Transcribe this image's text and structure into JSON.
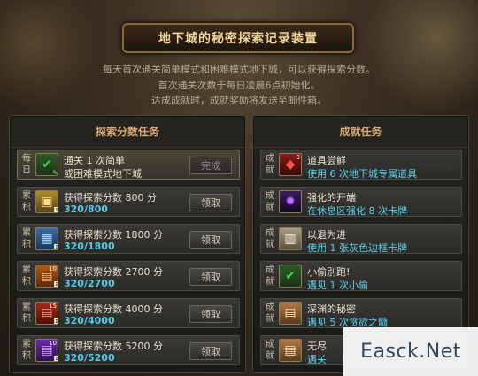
{
  "header": {
    "title": "地下城的秘密探索记录装置",
    "desc": [
      "每天首次通关简单模式和困难模式地下城，可以获得探索分数。",
      "首次通关次数于每日凌晨6点初始化。",
      "达成成就时，成就奖励将发送至邮件箱。"
    ]
  },
  "left_panel": {
    "title": "探索分数任务",
    "rows": [
      {
        "cat": [
          "每",
          "日"
        ],
        "line1": "通关 1 次简单",
        "line2": "或困难模式地下城",
        "button": "完成",
        "icon": "green-check-icon",
        "icon_num": ""
      },
      {
        "cat": [
          "累",
          "积"
        ],
        "line1": "获得探索分数 800 分",
        "line2": "320/800",
        "button": "领取",
        "icon": "gold-chest-icon",
        "icon_num": ""
      },
      {
        "cat": [
          "累",
          "积"
        ],
        "line1": "获得探索分数 1800 分",
        "line2": "320/1800",
        "button": "领取",
        "icon": "blue-gift-icon",
        "icon_num": ""
      },
      {
        "cat": [
          "累",
          "积"
        ],
        "line1": "获得探索分数 2700 分",
        "line2": "320/2700",
        "button": "领取",
        "icon": "orange-box-icon",
        "icon_num": "10"
      },
      {
        "cat": [
          "累",
          "积"
        ],
        "line1": "获得探索分数 4000 分",
        "line2": "320/4000",
        "button": "领取",
        "icon": "red-box-icon",
        "icon_num": "15"
      },
      {
        "cat": [
          "累",
          "积"
        ],
        "line1": "获得探索分数 5200 分",
        "line2": "320/5200",
        "button": "领取",
        "icon": "purple-box-icon",
        "icon_num": "10"
      }
    ]
  },
  "right_panel": {
    "title": "成就任务",
    "rows": [
      {
        "cat": [
          "成",
          "就"
        ],
        "line1": "道具尝鲜",
        "line2": "使用 6 次地下城专属道具",
        "icon": "red-gem-icon",
        "icon_num": "3"
      },
      {
        "cat": [
          "成",
          "就"
        ],
        "line1": "强化的开端",
        "line2": "在休息区强化 8 次卡牌",
        "icon": "purple-gem-icon",
        "icon_num": ""
      },
      {
        "cat": [
          "成",
          "就"
        ],
        "line1": "以退为进",
        "line2": "使用 1 张灰色边框卡牌",
        "icon": "card-icon",
        "icon_num": ""
      },
      {
        "cat": [
          "成",
          "就"
        ],
        "line1": "小偷别跑!",
        "line2": "遇见 1 次小偷",
        "icon": "green-check-icon",
        "icon_num": ""
      },
      {
        "cat": [
          "成",
          "就"
        ],
        "line1": "深渊的秘密",
        "line2": "遇见 5 次贪欲之髓",
        "icon": "scroll-icon",
        "icon_num": ""
      },
      {
        "cat": [
          "成",
          "就"
        ],
        "line1": "无尽",
        "line2": "遇关",
        "icon": "scroll-icon",
        "icon_num": ""
      }
    ]
  },
  "watermark": "Easck.Net"
}
